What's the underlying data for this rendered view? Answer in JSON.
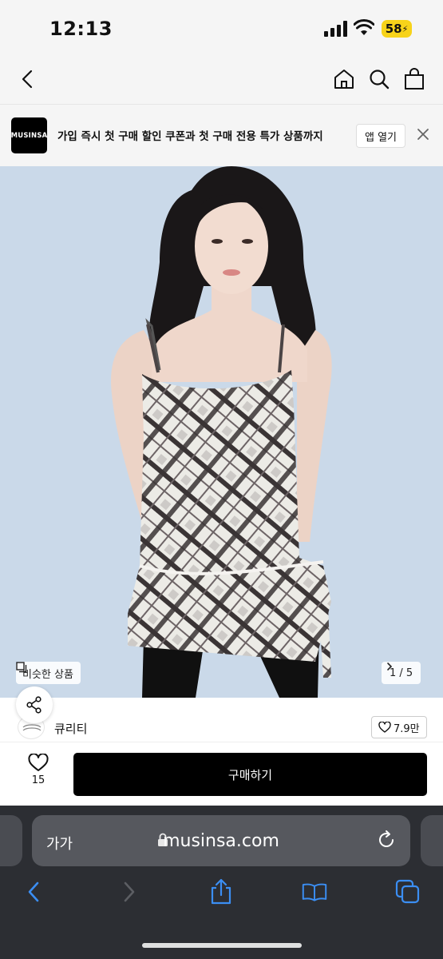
{
  "status": {
    "time": "12:13",
    "battery": "58"
  },
  "banner": {
    "logo": "MUSINSA",
    "text": "가입 즉시 첫 구매 할인 쿠폰과 첫 구매 전용 특가 상품까지",
    "open_app": "앱 열기"
  },
  "hero": {
    "similar_label": "비슷한 상품",
    "page_indicator": "1 / 5"
  },
  "brand": {
    "name": "큐리티",
    "likes": "7.9만"
  },
  "purchase": {
    "wish_count": "15",
    "buy_label": "구매하기"
  },
  "browser": {
    "text_size": "가가",
    "url": "musinsa.com"
  },
  "colors": {
    "accent": "#000000",
    "hero_bg": "#cad9e9",
    "battery": "#f7d31a",
    "toolbar_blue": "#3b8ef3"
  },
  "icons": [
    "back-icon",
    "home-icon",
    "search-icon",
    "bag-icon",
    "close-icon",
    "similar-icon",
    "chevron-right-icon",
    "share-icon",
    "heart-icon",
    "lock-icon",
    "reload-icon",
    "share-up-icon",
    "book-icon",
    "tabs-icon",
    "forward-icon"
  ]
}
